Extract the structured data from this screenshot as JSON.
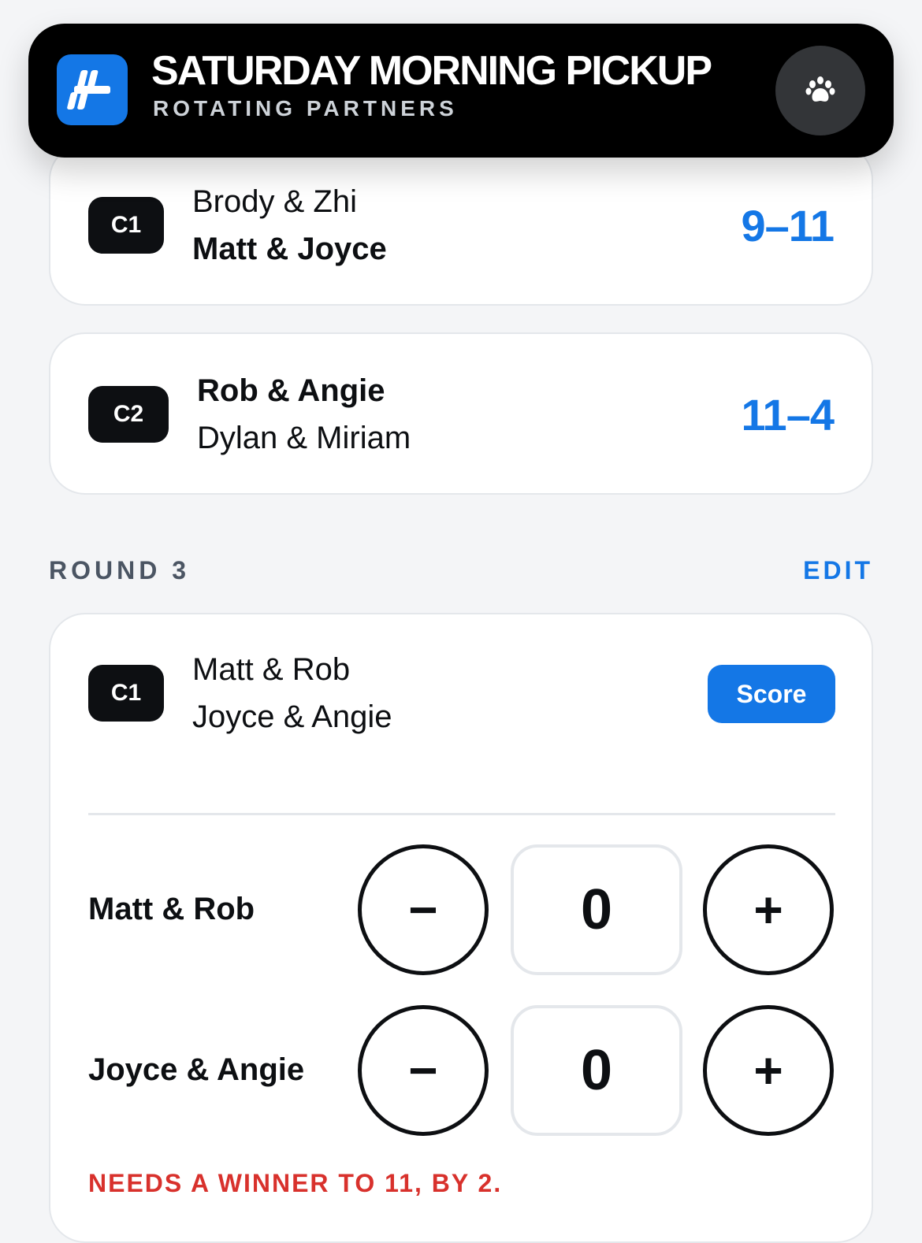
{
  "header": {
    "title": "SATURDAY MORNING PICKUP",
    "subtitle": "ROTATING PARTNERS",
    "logo_icon": "hash-icon",
    "menu_icon": "paw-icon"
  },
  "matches_round_2": [
    {
      "court": "C1",
      "team_a": "Brody & Zhi",
      "team_b": "Matt & Joyce",
      "winner": "team_b",
      "score": "9–11"
    },
    {
      "court": "C2",
      "team_a": "Rob & Angie",
      "team_b": "Dylan & Miriam",
      "winner": "team_a",
      "score": "11–4"
    }
  ],
  "round3": {
    "label": "ROUND 3",
    "edit_label": "EDIT",
    "match": {
      "court": "C1",
      "team_a": "Matt & Rob",
      "team_b": "Joyce & Angie",
      "score_button": "Score"
    },
    "scoring": [
      {
        "team": "Matt & Rob",
        "value": "0",
        "minus": "−",
        "plus": "+"
      },
      {
        "team": "Joyce & Angie",
        "value": "0",
        "minus": "−",
        "plus": "+"
      }
    ],
    "warning": "NEEDS A WINNER TO 11, BY 2."
  },
  "colors": {
    "accent": "#1477e6",
    "warning": "#d8312c",
    "dark": "#0d0f12",
    "background": "#f4f5f7"
  }
}
